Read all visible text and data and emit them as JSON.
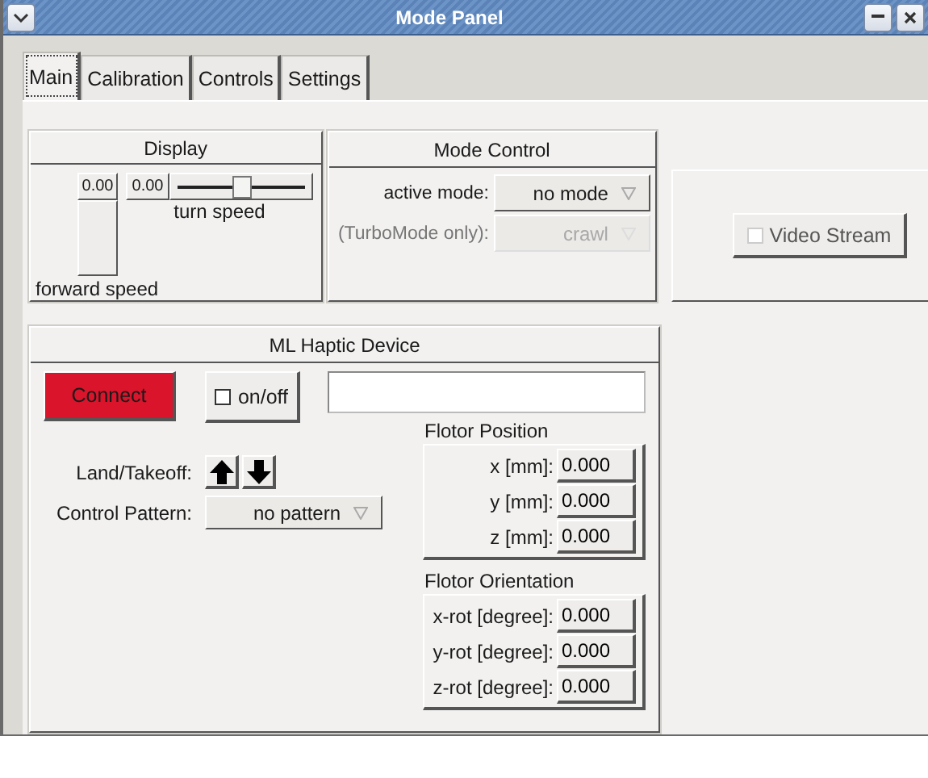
{
  "window": {
    "title": "Mode Panel"
  },
  "tabs": [
    {
      "label": "Main",
      "selected": true
    },
    {
      "label": "Calibration",
      "selected": false
    },
    {
      "label": "Controls",
      "selected": false
    },
    {
      "label": "Settings",
      "selected": false
    }
  ],
  "display": {
    "title": "Display",
    "forward_speed": {
      "label": "forward speed",
      "reading": "0.00",
      "level": 0
    },
    "turn_speed": {
      "label": "turn speed",
      "reading": "0.00",
      "level": 0.5
    }
  },
  "mode_control": {
    "title": "Mode Control",
    "rows": [
      {
        "label": "active mode:",
        "value": "no mode",
        "disabled": false
      },
      {
        "label": "(TurboMode only):",
        "value": "crawl",
        "disabled": true
      }
    ]
  },
  "video_stream": {
    "label": "Video Stream",
    "checked": false,
    "disabled": true
  },
  "haptic_device": {
    "title": "ML Haptic Device",
    "connect": {
      "label": "Connect",
      "color": "#d9142b"
    },
    "on_off": {
      "label": "on/off",
      "checked": false
    },
    "land_takeoff": {
      "label": "Land/Takeoff:"
    },
    "control_pattern": {
      "label": "Control Pattern:",
      "value": "no pattern"
    },
    "flotor_position": {
      "title": "Flotor Position",
      "rows": [
        {
          "label": "x [mm]:",
          "value": "0.000"
        },
        {
          "label": "y [mm]:",
          "value": "0.000"
        },
        {
          "label": "z [mm]:",
          "value": "0.000"
        }
      ]
    },
    "flotor_orientation": {
      "title": "Flotor Orientation",
      "rows": [
        {
          "label": "x-rot [degree]:",
          "value": "0.000"
        },
        {
          "label": "y-rot [degree]:",
          "value": "0.000"
        },
        {
          "label": "z-rot [degree]:",
          "value": "0.000"
        }
      ]
    }
  }
}
